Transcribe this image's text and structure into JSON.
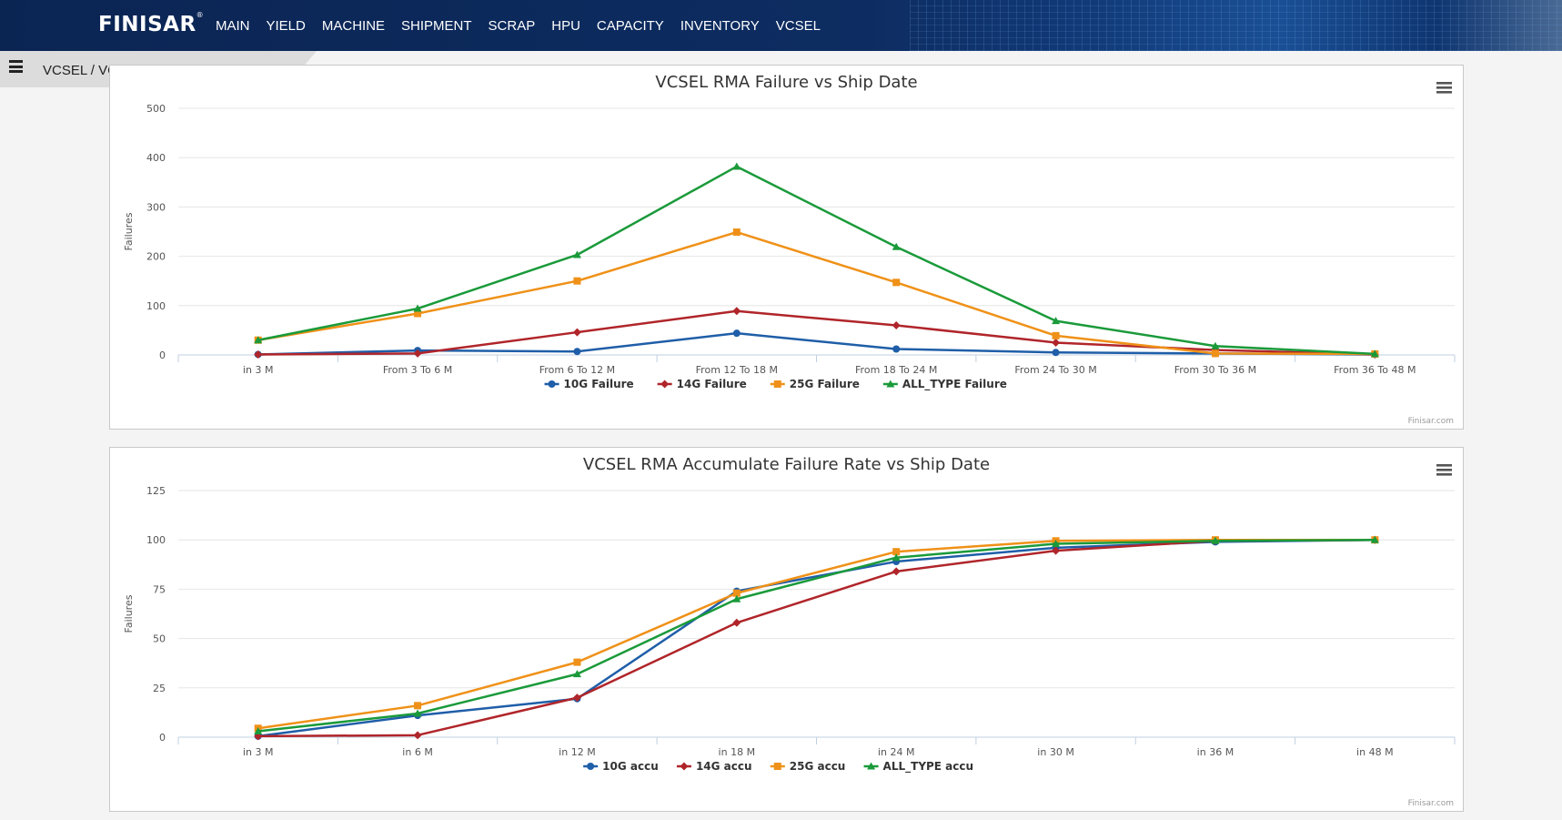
{
  "app": {
    "logo": "FINISAR",
    "logo_mark": "®",
    "nav": [
      "MAIN",
      "YIELD",
      "MACHINE",
      "SHIPMENT",
      "SCRAP",
      "HPU",
      "CAPACITY",
      "INVENTORY",
      "VCSEL"
    ],
    "breadcrumb": "VCSEL / VCSEL RMA STATISTIC",
    "credits": "Finisar.com"
  },
  "colors": {
    "10G": "#1f5ea8",
    "14G": "#b0252a",
    "25G": "#ef9118",
    "ALL_TYPE": "#1a9a3a"
  },
  "chart_data": [
    {
      "type": "line",
      "title": "VCSEL RMA Failure vs Ship Date",
      "ylabel": "Failures",
      "xlabel": "",
      "ylim": [
        0,
        500
      ],
      "yticks": [
        0,
        100,
        200,
        300,
        400,
        500
      ],
      "categories": [
        "in 3 M",
        "From 3 To 6 M",
        "From 6 To 12 M",
        "From 12 To 18 M",
        "From 18 To 24 M",
        "From 24 To 30 M",
        "From 30 To 36 M",
        "From 36 To 48 M"
      ],
      "grid": true,
      "legend": "bottom-center",
      "series": [
        {
          "name": "10G Failure",
          "key": "10G",
          "marker": "circle",
          "values": [
            1,
            9,
            7,
            44,
            12,
            5,
            3,
            1
          ]
        },
        {
          "name": "14G Failure",
          "key": "14G",
          "marker": "diamond",
          "values": [
            1,
            3,
            46,
            89,
            60,
            25,
            10,
            1
          ]
        },
        {
          "name": "25G Failure",
          "key": "25G",
          "marker": "square",
          "values": [
            30,
            84,
            150,
            249,
            147,
            39,
            3,
            2
          ]
        },
        {
          "name": "ALL_TYPE Failure",
          "key": "ALL_TYPE",
          "marker": "triangle",
          "values": [
            30,
            94,
            203,
            382,
            219,
            69,
            18,
            2
          ]
        }
      ]
    },
    {
      "type": "line",
      "title": "VCSEL RMA Accumulate Failure Rate vs Ship Date",
      "ylabel": "Failures",
      "xlabel": "",
      "ylim": [
        0,
        125
      ],
      "yticks": [
        0,
        25,
        50,
        75,
        100,
        125
      ],
      "categories": [
        "in 3 M",
        "in 6 M",
        "in 12 M",
        "in 18 M",
        "in 24 M",
        "in 30 M",
        "in 36 M",
        "in 48 M"
      ],
      "grid": true,
      "legend": "bottom-center",
      "series": [
        {
          "name": "10G accu",
          "key": "10G",
          "marker": "circle",
          "values": [
            0.5,
            11,
            19.5,
            74,
            89,
            96,
            99,
            100
          ]
        },
        {
          "name": "14G accu",
          "key": "14G",
          "marker": "diamond",
          "values": [
            0.5,
            1,
            20,
            58,
            84,
            94.5,
            99.5,
            100
          ]
        },
        {
          "name": "25G accu",
          "key": "25G",
          "marker": "square",
          "values": [
            4.5,
            16,
            38,
            73,
            94,
            99.5,
            100,
            100
          ]
        },
        {
          "name": "ALL_TYPE accu",
          "key": "ALL_TYPE",
          "marker": "triangle",
          "values": [
            3,
            12,
            32,
            70,
            91,
            98,
            99.5,
            100
          ]
        }
      ]
    }
  ]
}
